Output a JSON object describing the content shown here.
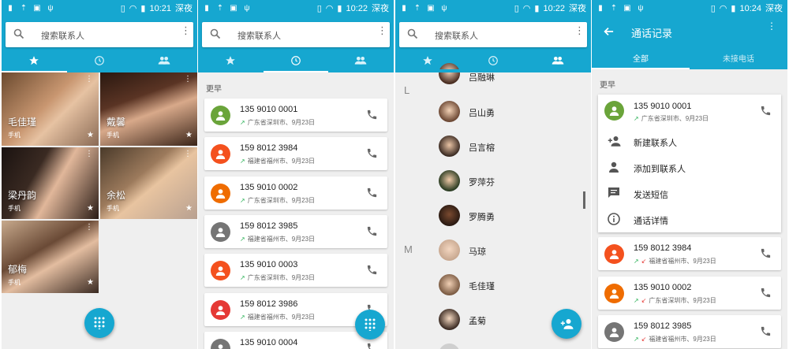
{
  "status": {
    "s1_time": "10:21",
    "s2_time": "10:22",
    "s3_time": "10:22",
    "s4_time": "10:24",
    "carrier": "深夜"
  },
  "search": {
    "placeholder": "搜索联系人"
  },
  "favorites": [
    {
      "name": "毛佳瑾",
      "phone": "手机"
    },
    {
      "name": "戴馨",
      "phone": "手机"
    },
    {
      "name": "梁丹韵",
      "phone": "手机"
    },
    {
      "name": "余松",
      "phone": "手机"
    },
    {
      "name": "郁梅",
      "phone": "手机"
    }
  ],
  "history": {
    "section": "更早",
    "items": [
      {
        "number": "135 9010 0001",
        "location": "广东省深圳市、9月23日",
        "color": "#6aa43a"
      },
      {
        "number": "159 8012 3984",
        "location": "福建省福州市、9月23日",
        "color": "#f4511e"
      },
      {
        "number": "135 9010 0002",
        "location": "广东省深圳市、9月23日",
        "color": "#ef6c00"
      },
      {
        "number": "159 8012 3985",
        "location": "福建省福州市、9月23日",
        "color": "#757575"
      },
      {
        "number": "135 9010 0003",
        "location": "广东省深圳市、9月23日",
        "color": "#f4511e"
      },
      {
        "number": "159 8012 3986",
        "location": "福建省福州市、9月23日",
        "color": "#e53935"
      },
      {
        "number": "135 9010 0004",
        "location": "",
        "color": "#757575"
      }
    ]
  },
  "contacts": {
    "top_name": "吕融琳",
    "letters": [
      "L",
      "M"
    ],
    "rows": [
      "吕山勇",
      "吕言榕",
      "罗萍芬",
      "罗腾勇",
      "马琼",
      "毛佳瑾",
      "孟菊"
    ]
  },
  "calllog": {
    "title": "通话记录",
    "tab_all": "全部",
    "tab_missed": "未接电话",
    "section": "更早",
    "expanded": {
      "number": "135 9010 0001",
      "location": "广东省深圳市、9月23日",
      "color": "#6aa43a"
    },
    "menu": [
      "新建联系人",
      "添加到联系人",
      "发送短信",
      "通话详情"
    ],
    "items": [
      {
        "number": "159 8012 3984",
        "location": "福建省福州市、9月23日",
        "color": "#f4511e"
      },
      {
        "number": "135 9010 0002",
        "location": "广东省深圳市、9月23日",
        "color": "#ef6c00"
      },
      {
        "number": "159 8012 3985",
        "location": "福建省福州市、9月23日",
        "color": "#757575"
      }
    ]
  },
  "colors": {
    "accent": "#16a7d0",
    "incoming": "#2fb35a",
    "missed": "#e53935"
  }
}
